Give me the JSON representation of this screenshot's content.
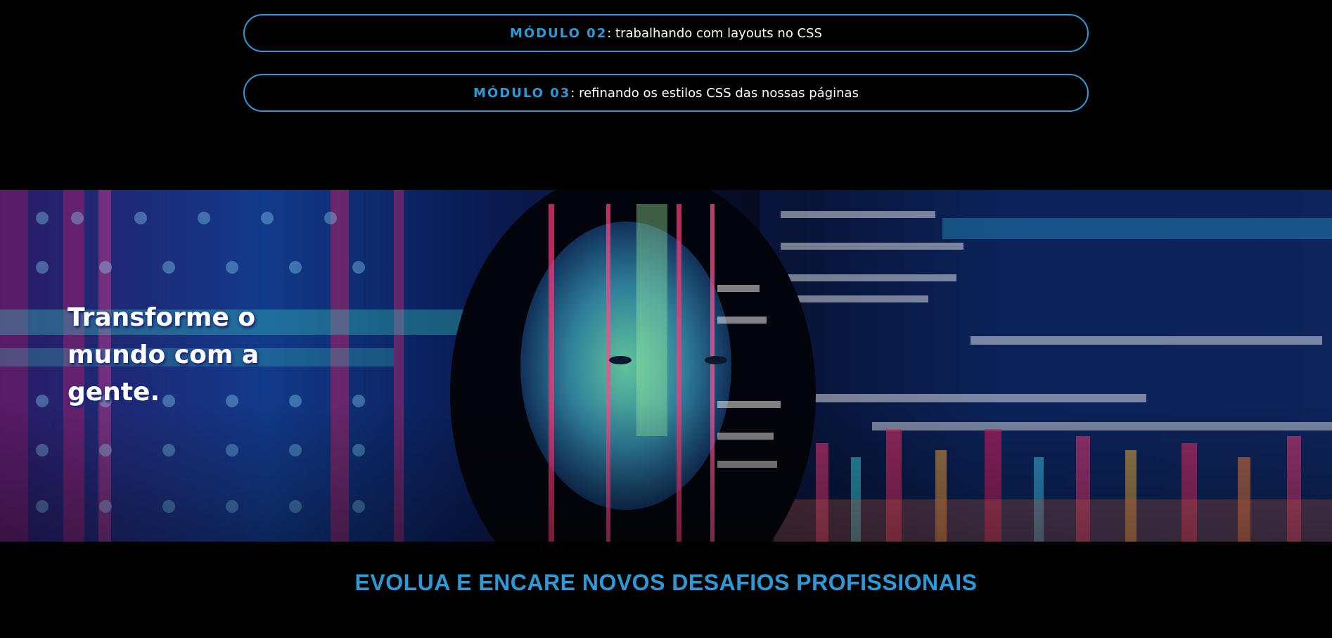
{
  "modules": [
    {
      "key": "MÓDULO 02",
      "separator": ":",
      "description": "trabalhando com layouts no CSS"
    },
    {
      "key": "MÓDULO 03",
      "separator": ":",
      "description": "refinando os estilos CSS das nossas páginas"
    }
  ],
  "hero": {
    "title": "Transforme o mundo com a gente."
  },
  "section": {
    "heading": "EVOLUA E ENCARE NOVOS DESAFIOS PROFISSIONAIS"
  },
  "colors": {
    "accent": "#2b9ad9",
    "background": "#000000",
    "text": "#ffffff"
  }
}
